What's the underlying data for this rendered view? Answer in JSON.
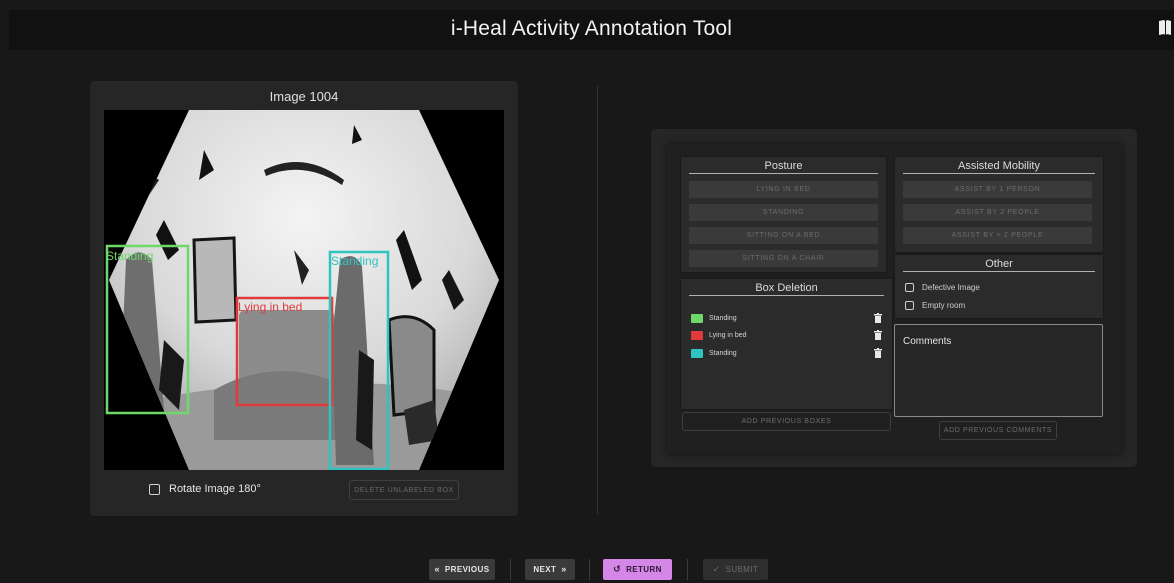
{
  "header": {
    "title": "i-Heal Activity Annotation Tool",
    "icon": "book-icon"
  },
  "image_card": {
    "title": "Image 1004",
    "rotate_label": "Rotate Image 180°",
    "delete_unlabeled_label": "DELETE UNLABELED BOX",
    "boxes": [
      {
        "label": "Standing",
        "color": "#6fd868"
      },
      {
        "label": "Lying in bed",
        "color": "#e03a3a"
      },
      {
        "label": "Standing",
        "color": "#2ec4c0"
      }
    ]
  },
  "posture": {
    "title": "Posture",
    "options": [
      "LYING IN BED",
      "STANDING",
      "SITTING ON A BED",
      "SITTING ON A CHAIR"
    ]
  },
  "mobility": {
    "title": "Assisted Mobility",
    "options": [
      "ASSIST BY 1 PERSON",
      "ASSIST BY 2 PEOPLE",
      "ASSIST BY > 2 PEOPLE"
    ]
  },
  "other": {
    "title": "Other",
    "options": [
      "Defective Image",
      "Empty room"
    ]
  },
  "box_deletion": {
    "title": "Box Deletion",
    "items": [
      {
        "label": "Standing",
        "color": "#6fd868"
      },
      {
        "label": "Lying in bed",
        "color": "#e03a3a"
      },
      {
        "label": "Standing",
        "color": "#2ec4c0"
      }
    ],
    "add_previous_label": "ADD PREVIOUS BOXES"
  },
  "comments": {
    "label": "Comments",
    "add_previous_label": "ADD PREVIOUS COMMENTS"
  },
  "nav": {
    "previous_label": "PREVIOUS",
    "next_label": "NEXT",
    "return_label": "RETURN",
    "submit_label": "SUBMIT",
    "previous_icon": "«",
    "next_icon": "»",
    "return_icon": "↺",
    "submit_icon": "✓"
  },
  "colors": {
    "return_accent": "#d487e6",
    "background": "#181818"
  }
}
